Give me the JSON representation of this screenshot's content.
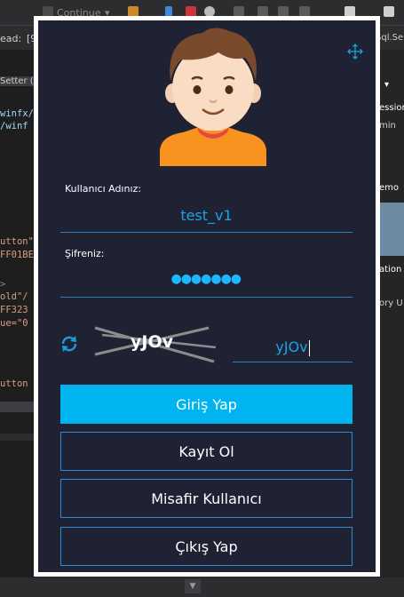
{
  "ide": {
    "toolbar_continue": "Continue",
    "row_label": "ead:",
    "row_value": "[9",
    "right_tab": "Sql.Se",
    "setter_label": "Setter (F",
    "code_lines": [
      {
        "text": "winfx/2",
        "color": "#c8c8c8"
      },
      {
        "text": "/winf",
        "color": "#c8c8c8"
      },
      {
        "text": "utton\"",
        "color": "#d69d85"
      },
      {
        "text": "FF01BE",
        "color": "#d69d85"
      },
      {
        "text": ">",
        "color": "#8a8a8a"
      },
      {
        "text": "old\"/",
        "color": "#d69d85"
      },
      {
        "text": "FF323",
        "color": "#d69d85"
      },
      {
        "text": "ue=\"0",
        "color": "#d69d85"
      },
      {
        "text": "utton",
        "color": "#d69d85"
      }
    ],
    "right_items": [
      "ession",
      "min",
      "emo",
      "ation",
      "ory U"
    ]
  },
  "login": {
    "username_label": "Kullanıcı Adınız:",
    "username_value": "test_v1",
    "password_label": "Şifreniz:",
    "password_dots": "●●●●●●●",
    "captcha_text": "yJOv",
    "captcha_input_value": "yJOv",
    "login_button": "Giriş Yap",
    "register_button": "Kayıt Ol",
    "guest_button": "Misafir Kullanıcı",
    "exit_button": "Çıkış Yap"
  },
  "colors": {
    "modal_bg": "#1f2233",
    "accent": "#00b4f0",
    "line": "#2e7fbf",
    "text_blue": "#1aa3e8"
  },
  "icons": {
    "move": "move-icon",
    "refresh": "refresh-icon",
    "avatar": "user-avatar-icon"
  }
}
